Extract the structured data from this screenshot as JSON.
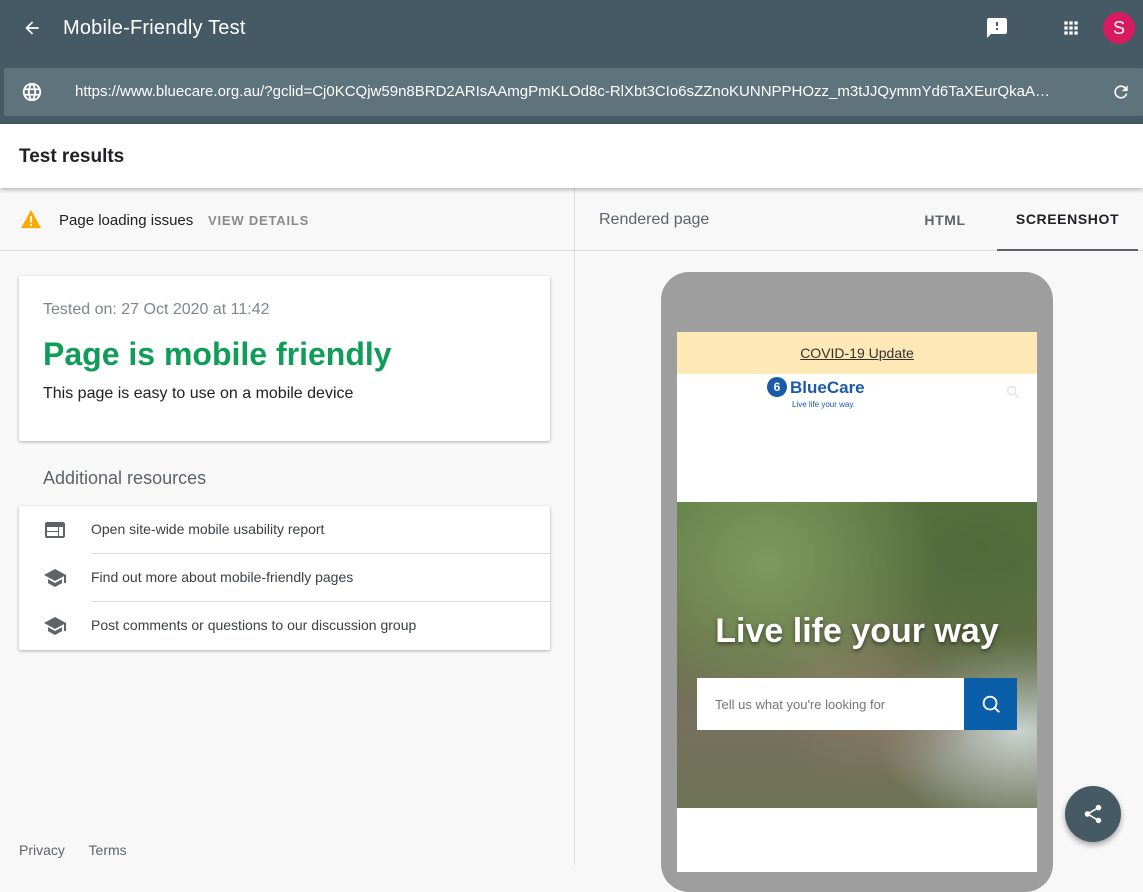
{
  "app": {
    "title": "Mobile-Friendly Test",
    "avatar_letter": "S",
    "colors": {
      "header": "#455a64",
      "urlbar": "#5f737d",
      "success": "#0f9d58",
      "avatar": "#d81b60",
      "warning": "#f9ab00"
    }
  },
  "toolbar": {
    "back_icon": "arrow-back-icon",
    "feedback_icon": "feedback-icon",
    "apps_icon": "apps-grid-icon"
  },
  "url_bar": {
    "url": "https://www.bluecare.org.au/?gclid=Cj0KCQjw59n8BRD2ARIsAAmgPmKLOd8c-RlXbt3CIo6sZZnoKUNNPPHOzz_m3tJJQymmYd6TaXEurQkaA…",
    "globe_icon": "globe-icon",
    "reload_icon": "reload-icon"
  },
  "results": {
    "title": "Test results",
    "issues_label": "Page loading issues",
    "view_details": "VIEW DETAILS",
    "tested_on": "Tested on: 27 Oct 2020 at 11:42",
    "verdict": "Page is mobile friendly",
    "verdict_sub": "This page is easy to use on a mobile device"
  },
  "resources": {
    "title": "Additional resources",
    "items": [
      {
        "label": "Open site-wide mobile usability report",
        "icon": "web-report-icon"
      },
      {
        "label": "Find out more about mobile-friendly pages",
        "icon": "school-icon"
      },
      {
        "label": "Post comments or questions to our discussion group",
        "icon": "school-icon"
      }
    ]
  },
  "footer": {
    "privacy": "Privacy",
    "terms": "Terms"
  },
  "rendered": {
    "label": "Rendered page",
    "tabs": [
      {
        "label": "HTML",
        "selected": false
      },
      {
        "label": "SCREENSHOT",
        "selected": true
      }
    ],
    "preview": {
      "covid_link": "COVID-19 Update",
      "logo_name": "BlueCare",
      "logo_tagline": "Live life your way.",
      "hero_text": "Live life your way",
      "search_placeholder": "Tell us what you're looking for"
    }
  },
  "share_icon": "share-icon"
}
